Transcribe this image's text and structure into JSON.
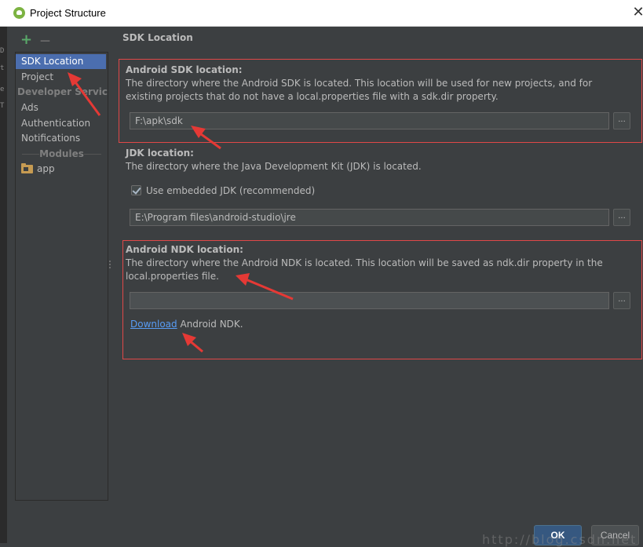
{
  "window": {
    "title": "Project Structure",
    "close_glyph": "✕"
  },
  "toolbar": {
    "add_glyph": "+",
    "remove_glyph": "—"
  },
  "sidebar": {
    "items": [
      {
        "label": "SDK Location",
        "selected": true
      },
      {
        "label": "Project"
      }
    ],
    "developer_services_header": "Developer Servic...",
    "developer_services": [
      {
        "label": "Ads"
      },
      {
        "label": "Authentication"
      },
      {
        "label": "Notifications"
      }
    ],
    "modules_header": "Modules",
    "modules": [
      {
        "label": "app",
        "icon": "folder-module-icon"
      }
    ]
  },
  "main": {
    "title": "SDK Location",
    "android_sdk": {
      "heading": "Android SDK location:",
      "description": "The directory where the Android SDK is located. This location will be used for new projects, and for existing projects that do not have a local.properties file with a sdk.dir property.",
      "path": "F:\\apk\\sdk",
      "browse": "..."
    },
    "jdk": {
      "heading": "JDK location:",
      "description": "The directory where the Java Development Kit (JDK) is located.",
      "checkbox_label": "Use embedded JDK (recommended)",
      "checkbox_checked": true,
      "path": "E:\\Program files\\android-studio\\jre",
      "browse": "..."
    },
    "android_ndk": {
      "heading": "Android NDK location:",
      "description": "The directory where the Android NDK is located. This location will be saved as ndk.dir property in the local.properties file.",
      "path": "",
      "browse": "...",
      "download_link": "Download",
      "download_suffix": "Android NDK."
    }
  },
  "footer": {
    "ok_label": "OK",
    "cancel_label": "Cancel"
  },
  "watermark": "http://blog.csdn.net",
  "colors": {
    "background": "#3c3f41",
    "selection": "#4b6eaf",
    "highlight_box": "#e04848",
    "annotation_arrow": "#e53935",
    "link": "#589df6",
    "ok_button": "#365880"
  }
}
